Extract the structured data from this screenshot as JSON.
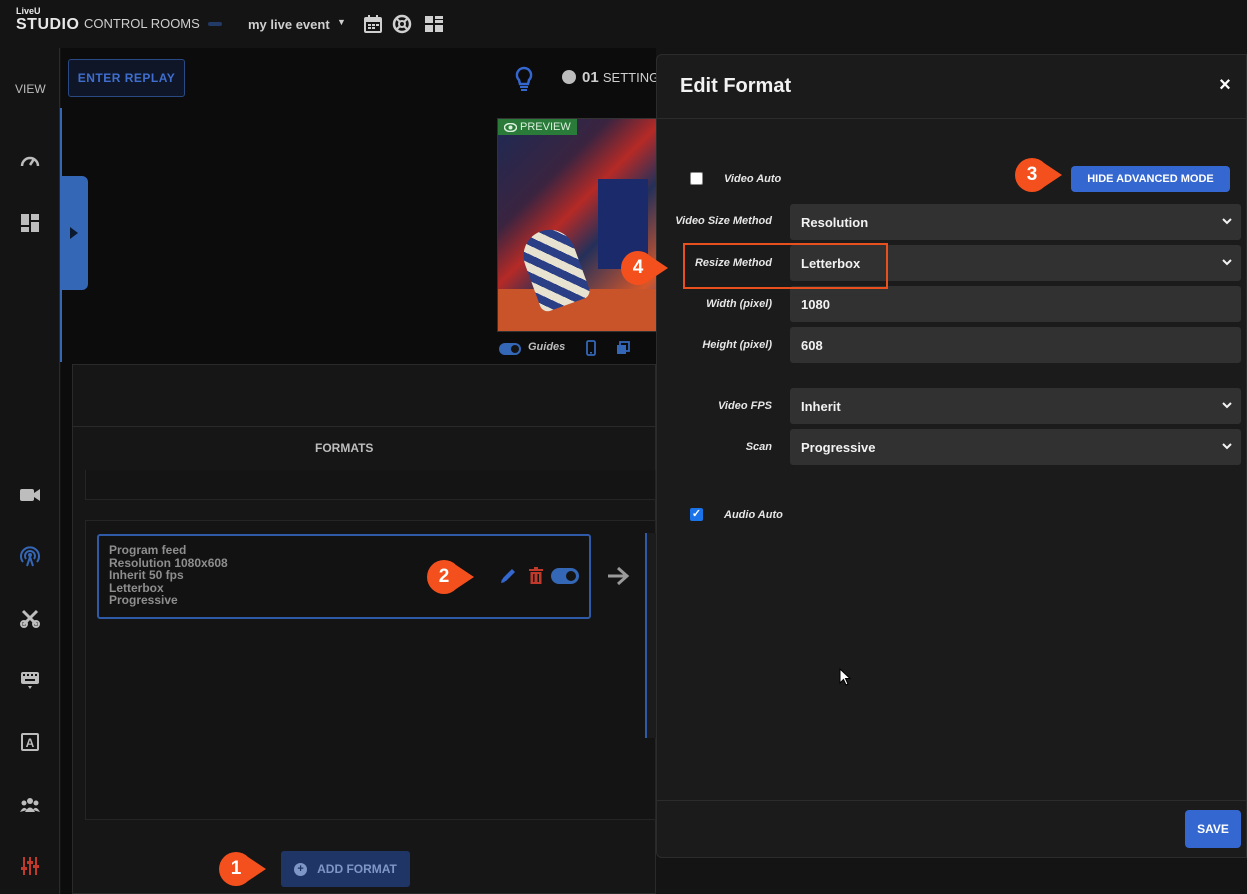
{
  "topbar": {
    "logo_line1": "LiveU",
    "logo_line2": "STUDIO",
    "control_rooms": "CONTROL ROOMS",
    "event_name": "my live event",
    "event_caret": "▼",
    "icons": [
      "calendar-icon",
      "help-lifebuoy-icon",
      "layout-icon"
    ]
  },
  "sidebar": {
    "view_label": "VIEW",
    "items": [
      "speedometer-icon",
      "dashboard-icon",
      "camera-icon",
      "broadcast-icon",
      "tools-icon",
      "keyboard-icon",
      "text-icon",
      "users-icon",
      "mixer-icon"
    ]
  },
  "main": {
    "enter_replay": "ENTER REPLAY",
    "setting_number": "01",
    "setting_label": "SETTING",
    "preview_badge": "PREVIEW",
    "guides_label": "Guides"
  },
  "formats": {
    "title": "FORMATS",
    "card_lines": [
      "Program feed",
      "Resolution 1080x608",
      "Inherit 50 fps",
      "Letterbox",
      "Progressive"
    ],
    "add_format": "ADD FORMAT",
    "add_format_plus": "+"
  },
  "modal": {
    "title": "Edit Format",
    "close": "×",
    "video_auto_label": "Video Auto",
    "video_auto_checked": false,
    "hide_advanced": "HIDE ADVANCED MODE",
    "fields": {
      "video_size_method": {
        "label": "Video Size Method",
        "value": "Resolution"
      },
      "resize_method": {
        "label": "Resize Method",
        "value": "Letterbox"
      },
      "width": {
        "label": "Width (pixel)",
        "value": "1080"
      },
      "height": {
        "label": "Height (pixel)",
        "value": "608"
      },
      "video_fps": {
        "label": "Video FPS",
        "value": "Inherit"
      },
      "scan": {
        "label": "Scan",
        "value": "Progressive"
      }
    },
    "audio_auto_label": "Audio Auto",
    "audio_auto_checked": true,
    "audio_auto_mark": "✓",
    "save": "SAVE"
  },
  "callouts": [
    "1",
    "2",
    "3",
    "4"
  ],
  "colors": {
    "accent": "#3567d0",
    "callout": "#f4501e",
    "highlight": "#e8501e",
    "delete": "#c0392b"
  }
}
